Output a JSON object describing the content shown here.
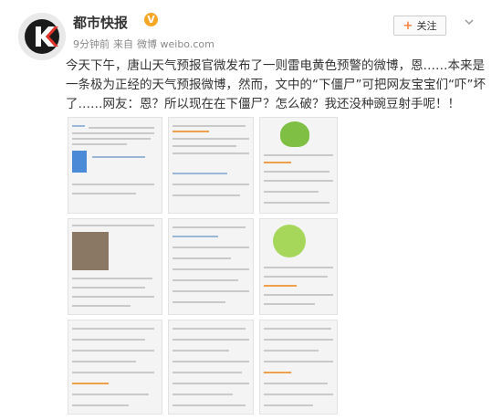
{
  "account": {
    "name": "都市快报",
    "verified_badge": "V",
    "time": "9分钟前",
    "source_prefix": "来自",
    "source": "微博 weibo.com"
  },
  "follow": {
    "label": "关注",
    "icon": "plus-icon"
  },
  "post": {
    "text": "今天下午，唐山天气预报官微发布了一则雷电黄色预警的微博，恩……本来是一条极为正经的天气预报微博，然而，文中的“下僵尸”可把网友宝宝们“吓”坏了……网友：恩？所以现在在下僵尸？怎么破？我还没种豌豆射手呢！！"
  },
  "colors": {
    "brand_orange": "#ff8140",
    "badge": "#f5a623",
    "text": "#333333",
    "meta": "#888888"
  }
}
